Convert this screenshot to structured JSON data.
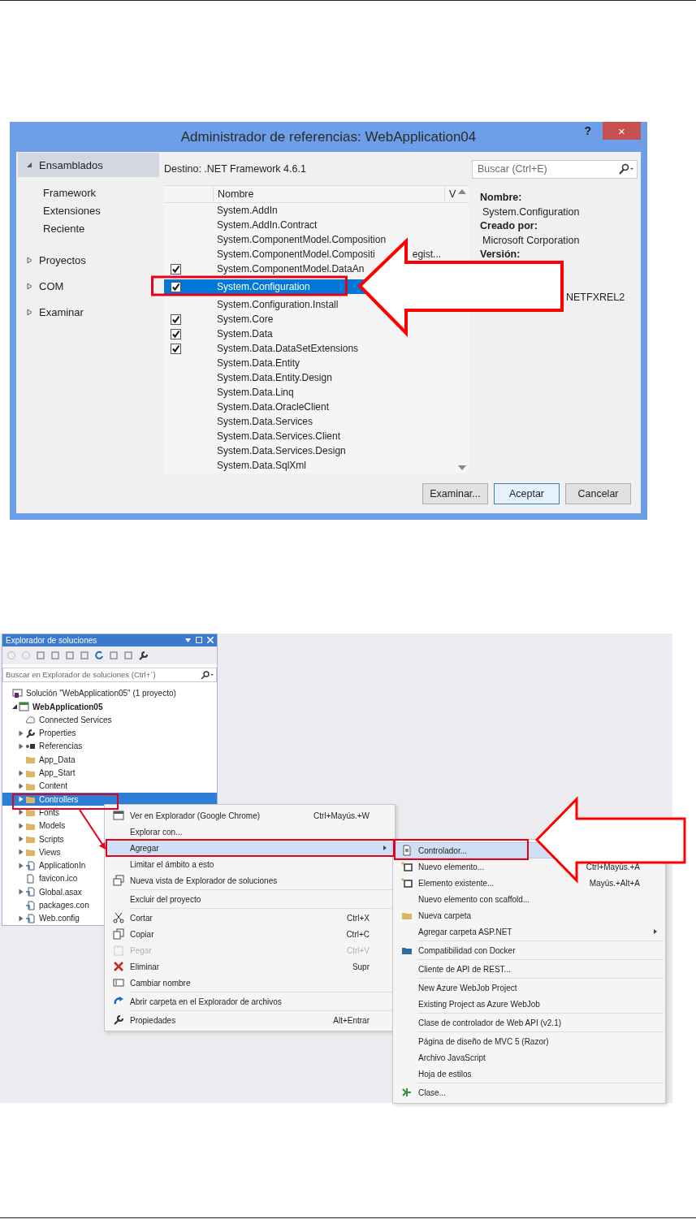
{
  "dialog": {
    "title": "Administrador de referencias: WebApplication04",
    "help": "?",
    "close": "×",
    "sidebar": [
      {
        "label": "Ensamblados",
        "expanded": true,
        "selected": true,
        "children": [
          {
            "label": "Framework"
          },
          {
            "label": "Extensiones"
          },
          {
            "label": "Reciente"
          }
        ]
      },
      {
        "label": "Proyectos",
        "expanded": false,
        "selected": false
      },
      {
        "label": "COM",
        "expanded": false,
        "selected": false
      },
      {
        "label": "Examinar",
        "expanded": false,
        "selected": false
      }
    ],
    "target": "Destino: .NET Framework 4.6.1",
    "search": {
      "placeholder": "Buscar (Ctrl+E)"
    },
    "list": {
      "columns": [
        "Nombre",
        "V"
      ],
      "rows": [
        {
          "name": "System.AddIn",
          "checked": false,
          "selected": false
        },
        {
          "name": "System.AddIn.Contract",
          "checked": false,
          "selected": false
        },
        {
          "name": "System.ComponentModel.Composition",
          "checked": false,
          "selected": false
        },
        {
          "name": "System.ComponentModel.Compositi",
          "name_tail": "egist...",
          "checked": false,
          "selected": false
        },
        {
          "name": "System.ComponentModel.DataAn",
          "checked": true,
          "selected": false
        },
        {
          "name": "System.Configuration",
          "checked": true,
          "selected": true
        },
        {
          "name": "System.Configuration.Install",
          "checked": false,
          "selected": false
        },
        {
          "name": "System.Core",
          "checked": true,
          "selected": false
        },
        {
          "name": "System.Data",
          "checked": true,
          "selected": false
        },
        {
          "name": "System.Data.DataSetExtensions",
          "checked": true,
          "selected": false
        },
        {
          "name": "System.Data.Entity",
          "checked": false,
          "selected": false
        },
        {
          "name": "System.Data.Entity.Design",
          "checked": false,
          "selected": false
        },
        {
          "name": "System.Data.Linq",
          "checked": false,
          "selected": false
        },
        {
          "name": "System.Data.OracleClient",
          "checked": false,
          "selected": false
        },
        {
          "name": "System.Data.Services",
          "checked": false,
          "selected": false
        },
        {
          "name": "System.Data.Services.Client",
          "checked": false,
          "selected": false
        },
        {
          "name": "System.Data.Services.Design",
          "checked": false,
          "selected": false
        },
        {
          "name": "System.Data.SqlXml",
          "checked": false,
          "selected": false
        }
      ]
    },
    "details": [
      {
        "label": "Nombre:",
        "value": "System.Configuration"
      },
      {
        "label": "Creado por:",
        "value": "Microsoft Corporation"
      },
      {
        "label": "Versión:"
      },
      {
        "value_tail": "NETFXREL2"
      }
    ],
    "buttons": [
      {
        "label": "Examinar...",
        "default": false
      },
      {
        "label": "Aceptar",
        "default": true
      },
      {
        "label": "Cancelar",
        "default": false
      }
    ]
  },
  "explorer": {
    "title": "Explorador de soluciones",
    "search": {
      "placeholder": "Buscar en Explorador de soluciones (Ctrl+´)"
    },
    "tree": [
      {
        "label": "Solución \"WebApplication05\" (1 proyecto)",
        "kind": "solution",
        "selected": false,
        "children": [
          {
            "label": "WebApplication05",
            "kind": "project",
            "expanded": true,
            "selected": false,
            "children": [
              {
                "label": "Connected Services",
                "kind": "service",
                "selected": false
              },
              {
                "label": "Properties",
                "kind": "wrench",
                "expanded": false,
                "selected": false
              },
              {
                "label": "Referencias",
                "kind": "references",
                "expanded": false,
                "selected": false
              },
              {
                "label": "App_Data",
                "kind": "folder",
                "selected": false
              },
              {
                "label": "App_Start",
                "kind": "folder",
                "expanded": false,
                "selected": false
              },
              {
                "label": "Content",
                "kind": "folder",
                "expanded": false,
                "selected": false
              },
              {
                "label": "Controllers",
                "kind": "folder",
                "expanded": false,
                "selected": true
              },
              {
                "label": "Fonts",
                "kind": "folder",
                "expanded": false,
                "selected": false
              },
              {
                "label": "Models",
                "kind": "folder",
                "expanded": false,
                "selected": false
              },
              {
                "label": "Scripts",
                "kind": "folder",
                "expanded": false,
                "selected": false
              },
              {
                "label": "Views",
                "kind": "folder",
                "expanded": false,
                "selected": false
              },
              {
                "label": "ApplicationIn",
                "kind": "config",
                "expanded": false,
                "selected": false
              },
              {
                "label": "favicon.ico",
                "kind": "file",
                "selected": false
              },
              {
                "label": "Global.asax",
                "kind": "config",
                "expanded": false,
                "selected": false
              },
              {
                "label": "packages.con",
                "kind": "config",
                "selected": false
              },
              {
                "label": "Web.config",
                "kind": "config",
                "expanded": false,
                "selected": false
              }
            ]
          }
        ]
      }
    ]
  },
  "context_menu": {
    "items": [
      {
        "kind": "browser",
        "label": "Ver en Explorador (Google Chrome)",
        "shortcut": "Ctrl+Mayús.+W",
        "submenu": false,
        "disabled": false,
        "selected": false
      },
      {
        "kind": "plain",
        "label": "Explorar con...",
        "submenu": false,
        "disabled": false,
        "selected": false
      },
      {
        "kind": "plain",
        "label": "Agregar",
        "submenu": true,
        "disabled": false,
        "selected": true
      },
      {
        "kind": "plain",
        "label": "Limitar el ámbito a esto",
        "submenu": false,
        "disabled": false,
        "selected": false
      },
      {
        "kind": "window",
        "label": "Nueva vista de Explorador de soluciones",
        "submenu": false,
        "disabled": false,
        "selected": false
      },
      {
        "kind": "separator"
      },
      {
        "kind": "plain",
        "label": "Excluir del proyecto",
        "submenu": false,
        "disabled": false,
        "selected": false
      },
      {
        "kind": "separator"
      },
      {
        "kind": "cut",
        "label": "Cortar",
        "shortcut": "Ctrl+X",
        "submenu": false,
        "disabled": false,
        "selected": false
      },
      {
        "kind": "copy",
        "label": "Copiar",
        "shortcut": "Ctrl+C",
        "submenu": false,
        "disabled": false,
        "selected": false
      },
      {
        "kind": "paste",
        "label": "Pegar",
        "shortcut": "Ctrl+V",
        "submenu": false,
        "disabled": true,
        "selected": false
      },
      {
        "kind": "delete",
        "label": "Eliminar",
        "shortcut": "Supr",
        "submenu": false,
        "disabled": false,
        "selected": false
      },
      {
        "kind": "rename",
        "label": "Cambiar nombre",
        "submenu": false,
        "disabled": false,
        "selected": false
      },
      {
        "kind": "separator"
      },
      {
        "kind": "refresh",
        "label": "Abrir carpeta en el Explorador de archivos",
        "submenu": false,
        "disabled": false,
        "selected": false
      },
      {
        "kind": "separator"
      },
      {
        "kind": "wrench",
        "label": "Propiedades",
        "shortcut": "Alt+Entrar",
        "submenu": false,
        "disabled": false,
        "selected": false
      }
    ]
  },
  "submenu": {
    "items": [
      {
        "kind": "file",
        "label": "Controlador...",
        "submenu": false,
        "disabled": false,
        "selected": true
      },
      {
        "kind": "new-item",
        "label": "Nuevo elemento...",
        "shortcut": "Ctrl+Mayús.+A",
        "submenu": false,
        "disabled": false,
        "selected": false
      },
      {
        "kind": "new-item",
        "label": "Elemento existente...",
        "shortcut": "Mayús.+Alt+A",
        "submenu": false,
        "disabled": false,
        "selected": false
      },
      {
        "kind": "plain",
        "label": "Nuevo elemento con scaffold...",
        "submenu": false,
        "disabled": false,
        "selected": false
      },
      {
        "kind": "folder",
        "label": "Nueva carpeta",
        "submenu": false,
        "disabled": false,
        "selected": false
      },
      {
        "kind": "plain",
        "label": "Agregar carpeta ASP.NET",
        "submenu": true,
        "disabled": false,
        "selected": false
      },
      {
        "kind": "separator"
      },
      {
        "kind": "docker",
        "label": "Compatibilidad con Docker",
        "submenu": false,
        "disabled": false,
        "selected": false
      },
      {
        "kind": "separator"
      },
      {
        "kind": "plain",
        "label": "Cliente de API de REST...",
        "submenu": false,
        "disabled": false,
        "selected": false
      },
      {
        "kind": "separator"
      },
      {
        "kind": "plain",
        "label": "New Azure WebJob Project",
        "submenu": false,
        "disabled": false,
        "selected": false
      },
      {
        "kind": "plain",
        "label": "Existing Project as Azure WebJob",
        "submenu": false,
        "disabled": false,
        "selected": false
      },
      {
        "kind": "separator"
      },
      {
        "kind": "plain",
        "label": "Clase de controlador de Web API (v2.1)",
        "submenu": false,
        "disabled": false,
        "selected": false
      },
      {
        "kind": "separator"
      },
      {
        "kind": "plain",
        "label": "Página de diseño de MVC 5 (Razor)",
        "submenu": false,
        "disabled": false,
        "selected": false
      },
      {
        "kind": "plain",
        "label": "Archivo JavaScript",
        "submenu": false,
        "disabled": false,
        "selected": false
      },
      {
        "kind": "plain",
        "label": "Hoja de estilos",
        "submenu": false,
        "disabled": false,
        "selected": false
      },
      {
        "kind": "separator"
      },
      {
        "kind": "class",
        "label": "Clase...",
        "submenu": false,
        "disabled": false,
        "selected": false
      }
    ]
  }
}
